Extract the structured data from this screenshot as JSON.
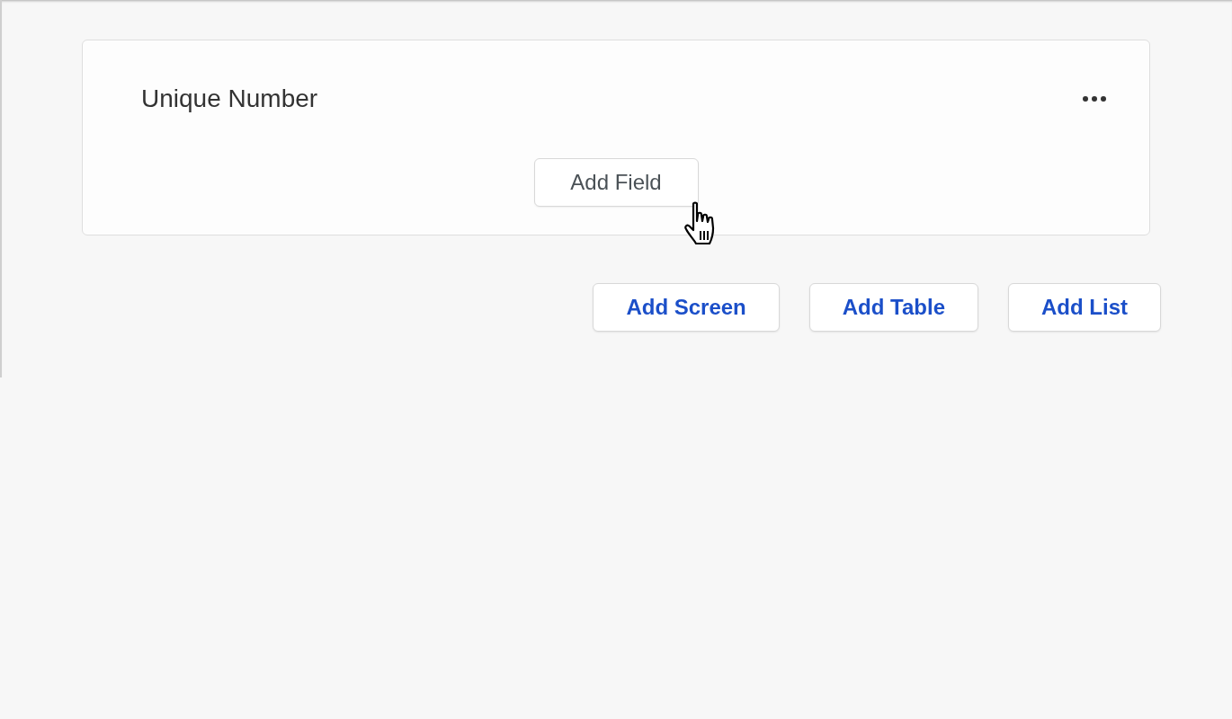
{
  "card": {
    "title": "Unique Number",
    "add_button": "Add Field"
  },
  "actions": [
    "Add Screen",
    "Add Table",
    "Add List"
  ]
}
